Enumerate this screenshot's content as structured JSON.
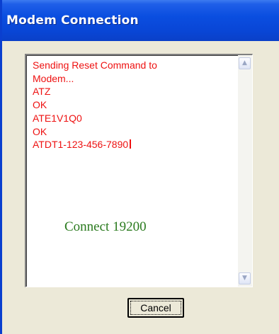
{
  "window": {
    "title": "Modem Connection"
  },
  "log": {
    "lines": [
      "Sending Reset Command to",
      "Modem...",
      "ATZ",
      "OK",
      "ATE1V1Q0",
      "OK",
      "ATDT1-123-456-7890"
    ],
    "overlay_text": "Connect 19200",
    "text_color": "#ee1111",
    "overlay_color": "#2a7a1e"
  },
  "scrollbar": {
    "up_icon": "scroll-up-arrow-icon",
    "down_icon": "scroll-down-arrow-icon"
  },
  "buttons": {
    "cancel_label": "Cancel"
  },
  "colors": {
    "titlebar": "#0a4ee0",
    "dialog_background": "#ece9d8"
  }
}
